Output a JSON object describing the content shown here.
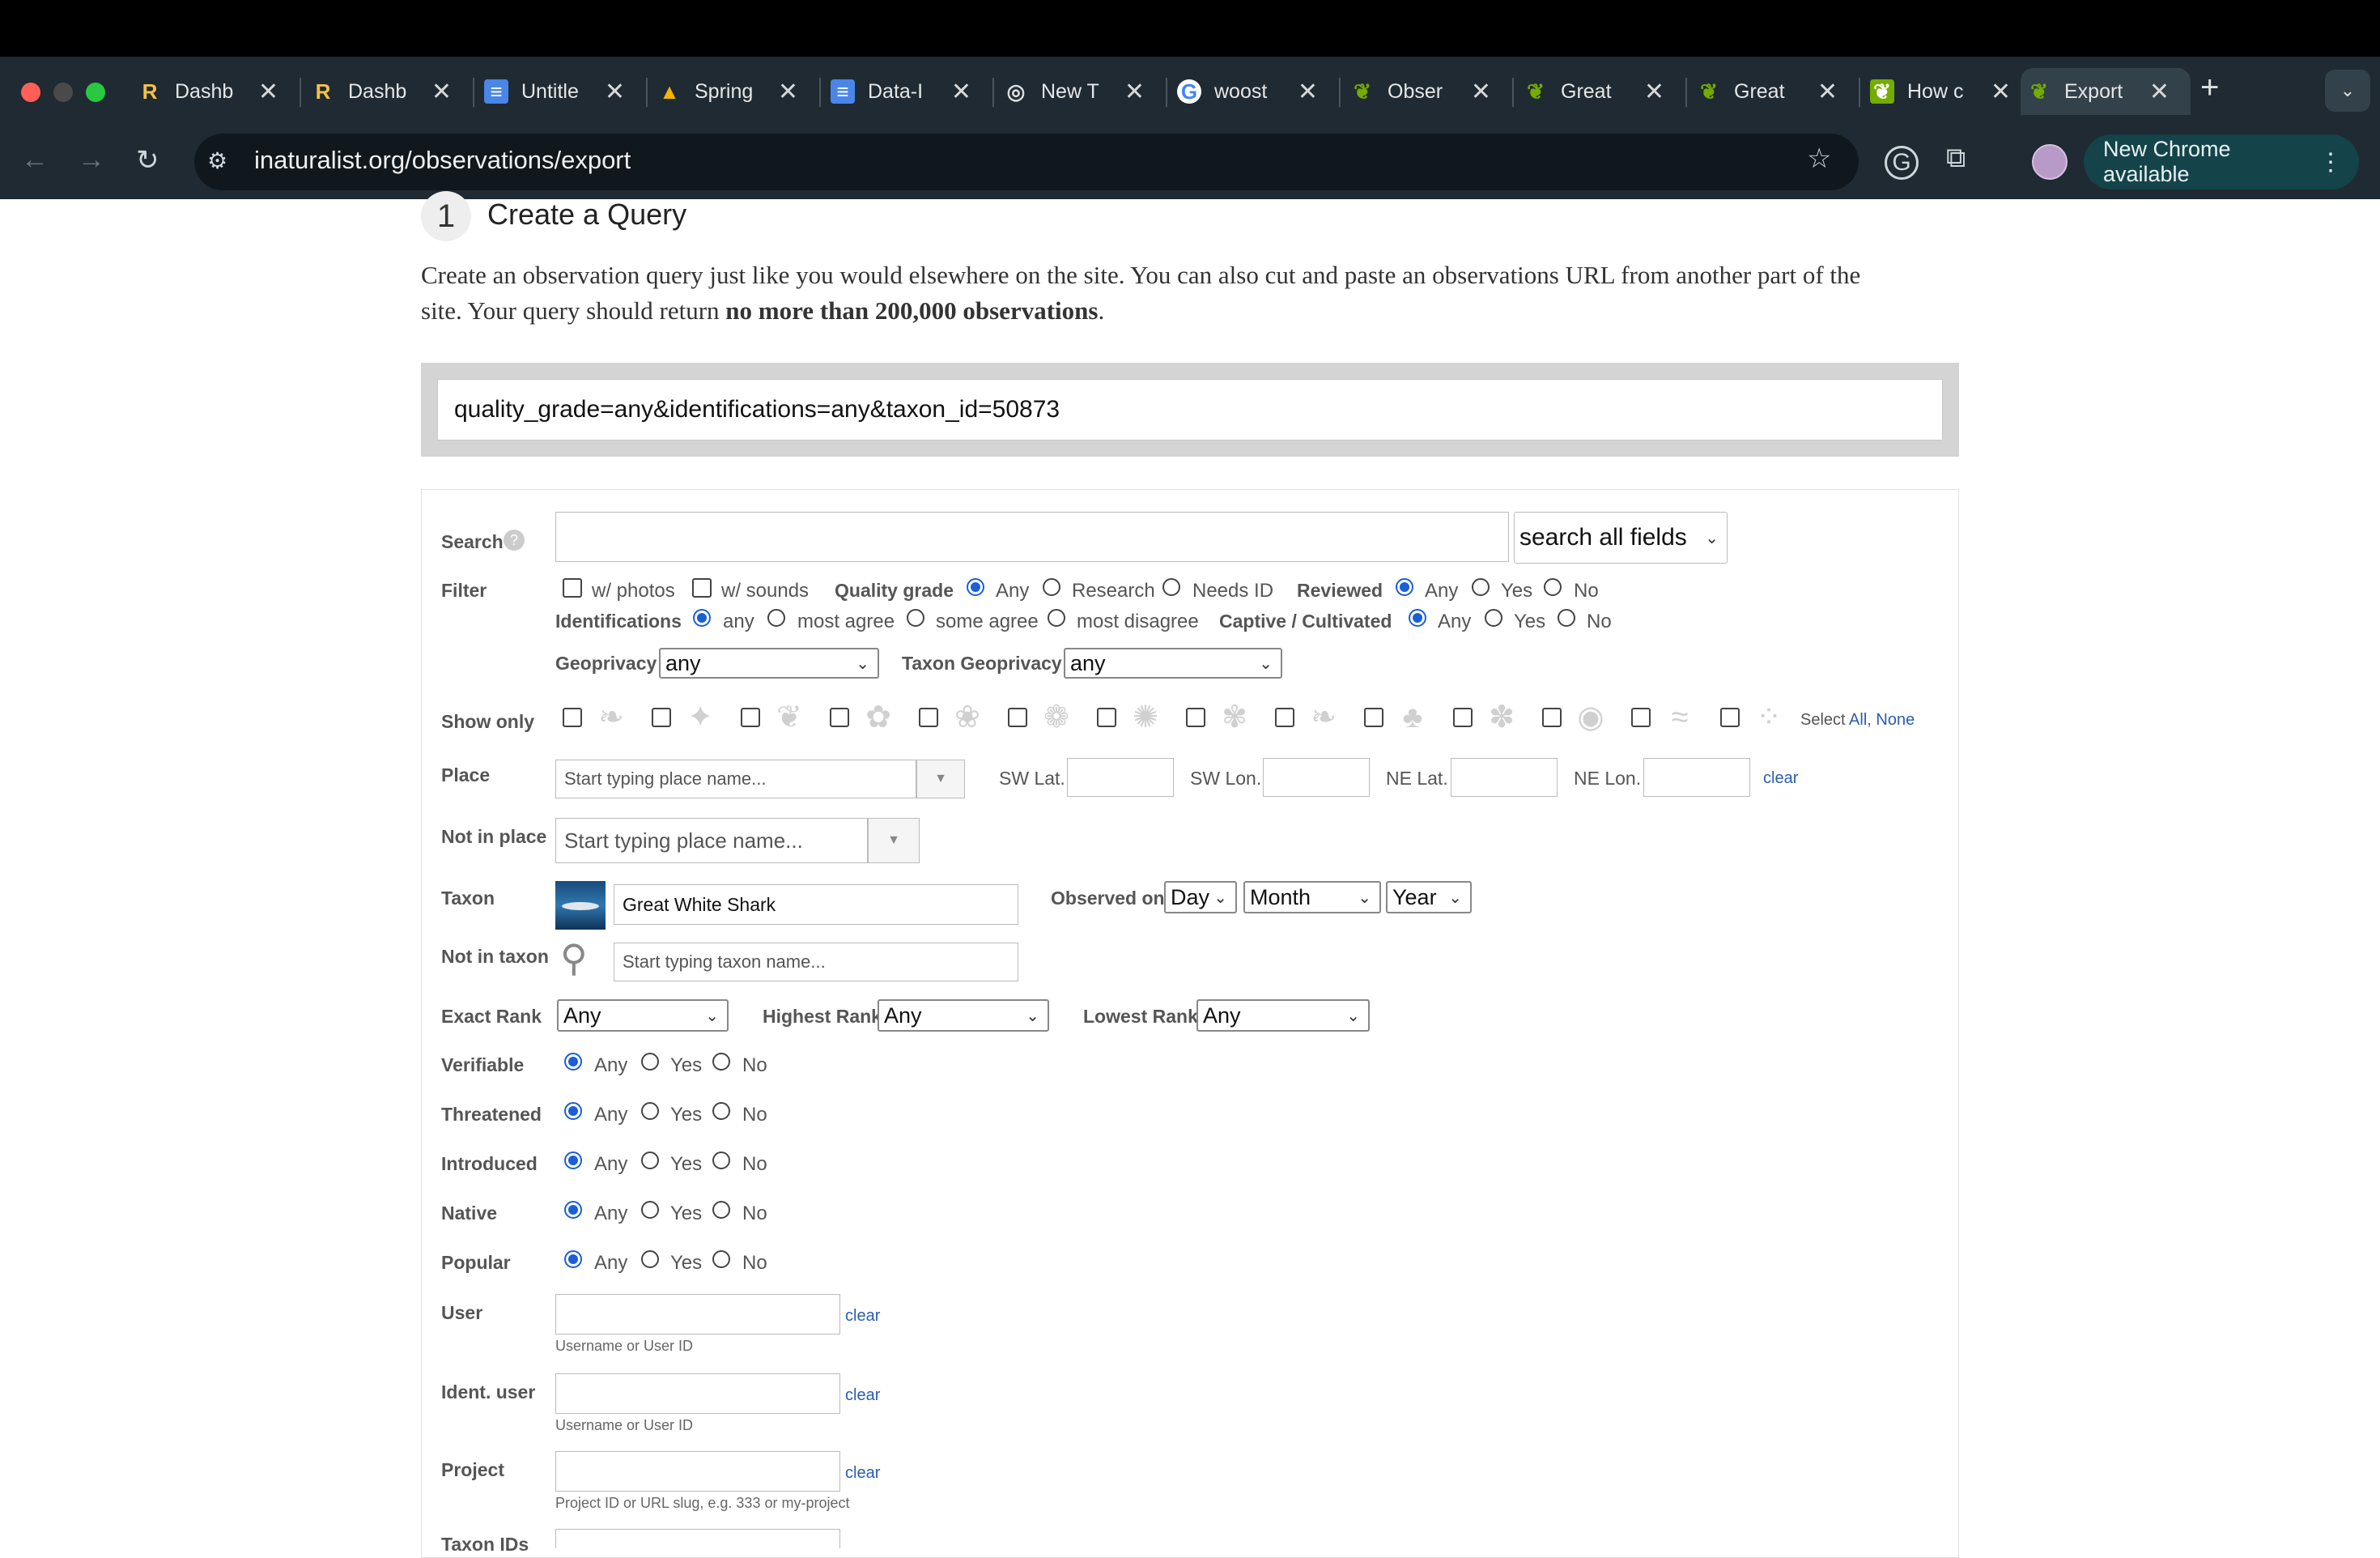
{
  "browser": {
    "tabs": [
      {
        "label": "Dashb",
        "icon": "R"
      },
      {
        "label": "Dashb",
        "icon": "R"
      },
      {
        "label": "Untitle",
        "icon": "≡"
      },
      {
        "label": "Spring",
        "icon": "▲"
      },
      {
        "label": "Data-I",
        "icon": "≡"
      },
      {
        "label": "New T",
        "icon": "◎"
      },
      {
        "label": "woost",
        "icon": "G"
      },
      {
        "label": "Obser",
        "icon": "❦"
      },
      {
        "label": "Great",
        "icon": "❦"
      },
      {
        "label": "Great",
        "icon": "❦"
      },
      {
        "label": "How c",
        "icon": "❦"
      },
      {
        "label": "Export",
        "icon": "❦"
      }
    ],
    "url": "inaturalist.org/observations/export",
    "new_chrome": "New Chrome available",
    "new_tab_icon": "+",
    "close_icon": "✕"
  },
  "page": {
    "step_number": "1",
    "step_title": "Create a Query",
    "intro_part1": "Create an observation query just like you would elsewhere on the site. You can also cut and paste an observations URL from another part of the",
    "intro_part2": "site. Your query should return ",
    "intro_bold": "no more than 200,000 observations",
    "intro_end": ".",
    "query_string": "quality_grade=any&identifications=any&taxon_id=50873"
  },
  "form": {
    "search": {
      "label": "Search",
      "value": "",
      "scope": "search all fields"
    },
    "filter": {
      "label": "Filter",
      "photos": "w/ photos",
      "sounds": "w/ sounds",
      "quality_grade_label": "Quality grade",
      "quality_options": [
        "Any",
        "Research",
        "Needs ID"
      ],
      "quality_selected": "Any",
      "reviewed_label": "Reviewed",
      "reviewed_options": [
        "Any",
        "Yes",
        "No"
      ],
      "identifications_label": "Identifications",
      "ident_options": [
        "any",
        "most agree",
        "some agree",
        "most disagree"
      ],
      "captive_label": "Captive / Cultivated",
      "captive_options": [
        "Any",
        "Yes",
        "No"
      ],
      "geoprivacy_label": "Geoprivacy",
      "geoprivacy_value": "any",
      "taxon_geoprivacy_label": "Taxon Geoprivacy",
      "taxon_geoprivacy_value": "any"
    },
    "show_only": {
      "label": "Show only",
      "select_prefix": "Select",
      "all": "All,",
      "none": "None",
      "icons": [
        "leaf-icon",
        "bird-icon",
        "hand-icon",
        "frog-icon",
        "fish-icon",
        "turtle-icon",
        "spider-icon",
        "insect-icon",
        "feather-icon",
        "mushroom-icon",
        "paw-icon",
        "snail-icon",
        "wave-icon",
        "dots-icon"
      ]
    },
    "place": {
      "label": "Place",
      "placeholder": "Start typing place name...",
      "sw_lat": "SW Lat.",
      "sw_lon": "SW Lon.",
      "ne_lat": "NE Lat.",
      "ne_lon": "NE Lon.",
      "clear": "clear"
    },
    "not_in_place": {
      "label": "Not in place",
      "placeholder": "Start typing place name..."
    },
    "taxon": {
      "label": "Taxon",
      "value": "Great White Shark",
      "observed_on": "Observed on",
      "day": "Day",
      "month": "Month",
      "year": "Year"
    },
    "not_in_taxon": {
      "label": "Not in taxon",
      "placeholder": "Start typing taxon name..."
    },
    "rank": {
      "exact_label": "Exact Rank",
      "exact_value": "Any",
      "highest_label": "Highest Rank",
      "highest_value": "Any",
      "lowest_label": "Lowest Rank",
      "lowest_value": "Any"
    },
    "tri_options": [
      "Any",
      "Yes",
      "No"
    ],
    "verifiable": "Verifiable",
    "threatened": "Threatened",
    "introduced": "Introduced",
    "native": "Native",
    "popular": "Popular",
    "user": {
      "label": "User",
      "clear": "clear",
      "help": "Username or User ID"
    },
    "ident_user": {
      "label": "Ident. user",
      "clear": "clear",
      "help": "Username or User ID"
    },
    "project": {
      "label": "Project",
      "clear": "clear",
      "help": "Project ID or URL slug, e.g. 333 or my-project"
    },
    "taxon_ids": {
      "label": "Taxon IDs"
    }
  },
  "colors": {
    "accent": "#1a5fd6",
    "link": "#2a5db0",
    "chrome_bg": "#1f2a32"
  }
}
